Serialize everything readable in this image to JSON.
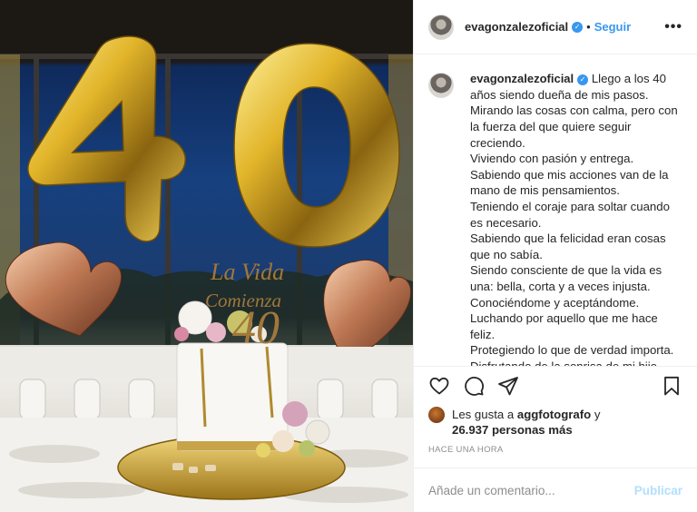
{
  "post": {
    "username": "evagonzalezoficial",
    "verified": true,
    "separator": "•",
    "follow_label": "Seguir",
    "more_label": "•••",
    "caption_lines": [
      "Llego a los 40",
      "años siendo dueña de mis pasos.",
      "Mirando las cosas con calma, pero con",
      "la fuerza del que quiere seguir",
      "creciendo.",
      "Viviendo con pasión y entrega.",
      "Sabiendo que mis acciones van de la",
      "mano de mis pensamientos.",
      "Teniendo el coraje para soltar cuando",
      "es necesario.",
      "Sabiendo que la felicidad eran cosas",
      "que no sabía.",
      "Siendo consciente de que la vida es",
      "una: bella, corta y a veces injusta.",
      "Conociéndome y aceptándome.",
      "Luchando por aquello que me hace",
      "feliz.",
      "Protegiendo lo que de verdad importa.",
      "Disfrutando de la sonrisa de mi hijo."
    ]
  },
  "photo": {
    "balloon_number": "40",
    "cake_topper_line1": "La Vida",
    "cake_topper_line2": "Comienza",
    "cake_topper_number": "40"
  },
  "actions": {
    "like_icon": "heart-icon",
    "comment_icon": "comment-icon",
    "share_icon": "paper-plane-icon",
    "save_icon": "bookmark-icon"
  },
  "likes": {
    "prefix": "Les gusta a ",
    "first_user": "aggfotografo",
    "connector": " y",
    "count": "26.937 personas más"
  },
  "timestamp": "HACE UNA HORA",
  "comment": {
    "placeholder": "Añade un comentario...",
    "publish_label": "Publicar"
  },
  "colors": {
    "accent": "#3897f0",
    "publish_disabled": "#b2dffc",
    "muted": "#8e8e8e",
    "text": "#262626",
    "border": "#efefef"
  }
}
